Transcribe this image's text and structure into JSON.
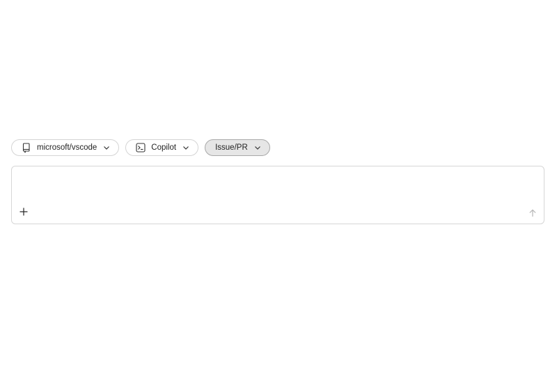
{
  "toolbar": {
    "repo_label": "microsoft/vscode",
    "agent_label": "Copilot",
    "context_label": "Issue/PR",
    "icons": {
      "repo": "repo-book-icon",
      "agent": "terminal-icon",
      "chevron": "chevron-down-icon"
    }
  },
  "composer": {
    "value": "",
    "placeholder": "",
    "add_icon": "plus-icon",
    "send_icon": "arrow-up-icon"
  }
}
